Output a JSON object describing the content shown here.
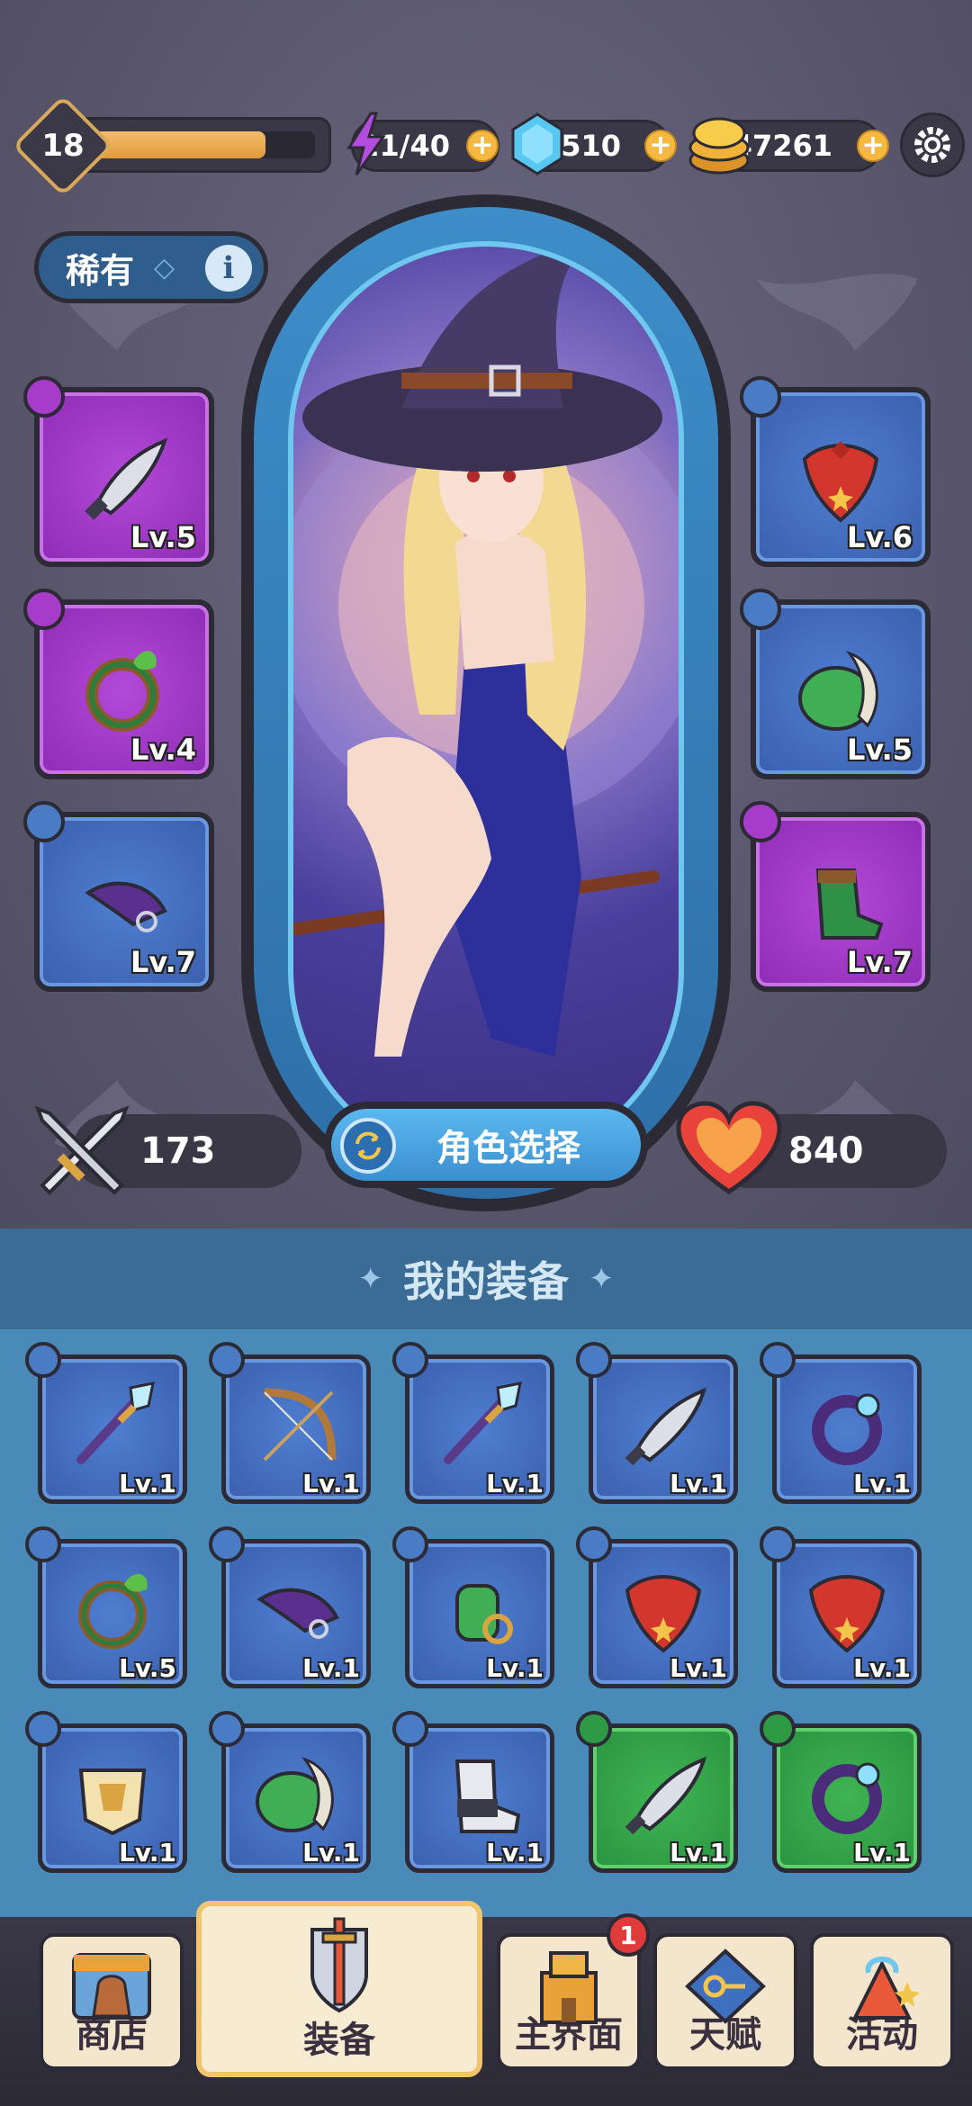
{
  "player": {
    "level": "18",
    "xp_progress": 0.78
  },
  "resources": {
    "energy": "21/40",
    "gems": "1510",
    "coins": "47261"
  },
  "rarity": {
    "label": "稀有",
    "info_icon": "i"
  },
  "character": {
    "name_hidden": ""
  },
  "equipped": {
    "left": [
      {
        "slot": "weapon",
        "level": "Lv.5",
        "color": "#a73ccb"
      },
      {
        "slot": "ring",
        "level": "Lv.4",
        "color": "#a73ccb"
      },
      {
        "slot": "hat",
        "level": "Lv.7",
        "color": "#3b5fae"
      }
    ],
    "right": [
      {
        "slot": "necklace",
        "level": "Lv.6",
        "color": "#3b5fae"
      },
      {
        "slot": "armor",
        "level": "Lv.5",
        "color": "#3b5fae"
      },
      {
        "slot": "boots",
        "level": "Lv.7",
        "color": "#a73ccb"
      }
    ]
  },
  "stats": {
    "attack": "173",
    "hp": "840",
    "select_label": "角色选择"
  },
  "inventory": {
    "title": "我的装备",
    "items": [
      {
        "type": "staff",
        "level": "Lv.1",
        "rarity": "blue"
      },
      {
        "type": "bow",
        "level": "Lv.1",
        "rarity": "blue"
      },
      {
        "type": "staff",
        "level": "Lv.1",
        "rarity": "blue"
      },
      {
        "type": "sword",
        "level": "Lv.1",
        "rarity": "blue"
      },
      {
        "type": "ring",
        "level": "Lv.1",
        "rarity": "blue"
      },
      {
        "type": "ring-leaf",
        "level": "Lv.5",
        "rarity": "blue"
      },
      {
        "type": "hat",
        "level": "Lv.1",
        "rarity": "blue"
      },
      {
        "type": "gauntlet",
        "level": "Lv.1",
        "rarity": "blue"
      },
      {
        "type": "necklace",
        "level": "Lv.1",
        "rarity": "blue"
      },
      {
        "type": "necklace",
        "level": "Lv.1",
        "rarity": "blue"
      },
      {
        "type": "armor-gold",
        "level": "Lv.1",
        "rarity": "blue"
      },
      {
        "type": "armor-green",
        "level": "Lv.1",
        "rarity": "blue"
      },
      {
        "type": "boots",
        "level": "Lv.1",
        "rarity": "blue"
      },
      {
        "type": "sword",
        "level": "Lv.1",
        "rarity": "green"
      },
      {
        "type": "ring",
        "level": "Lv.1",
        "rarity": "green"
      }
    ]
  },
  "nav": {
    "shop": "商店",
    "equip": "装备",
    "main": "主界面",
    "talent": "天赋",
    "events": "活动",
    "main_badge": "1"
  }
}
